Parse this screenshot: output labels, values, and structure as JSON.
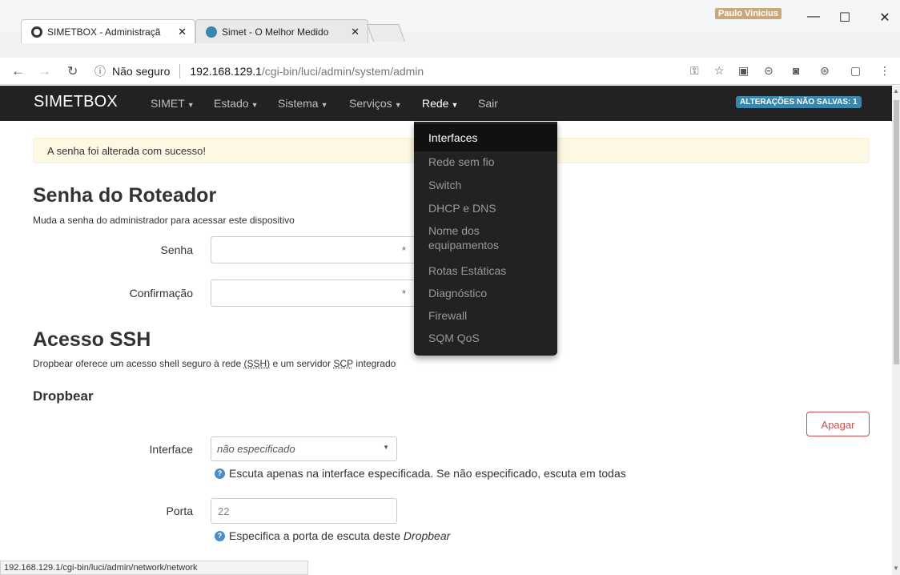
{
  "browser": {
    "tabs": [
      {
        "title": "SIMETBOX - Administraçã",
        "active": true
      },
      {
        "title": "Simet - O Melhor Medido",
        "active": false
      }
    ],
    "tab_close": "✕",
    "user": "Paulo Vinicius",
    "window_controls": {
      "minimize": "—",
      "maximize": "☐",
      "close": "✕"
    },
    "security_label": "Não seguro",
    "url_host": "192.168.129.1",
    "url_path": "/cgi-bin/luci/admin/system/admin",
    "status_url": "192.168.129.1/cgi-bin/luci/admin/network/network"
  },
  "navbar": {
    "brand": "SIMETBOX",
    "items": [
      {
        "label": "SIMET"
      },
      {
        "label": "Estado"
      },
      {
        "label": "Sistema"
      },
      {
        "label": "Serviços"
      },
      {
        "label": "Rede"
      },
      {
        "label": "Sair"
      }
    ],
    "caret": "▼",
    "unsaved_badge": "ALTERAÇÕES NÃO SALVAS: 1"
  },
  "dropdown": {
    "items": [
      {
        "label": "Interfaces",
        "active": true
      },
      {
        "label": "Rede sem fio"
      },
      {
        "label": "Switch"
      },
      {
        "label": "DHCP e DNS"
      },
      {
        "label": "Nome dos equipamentos"
      },
      {
        "label": "Rotas Estáticas"
      },
      {
        "label": "Diagnóstico"
      },
      {
        "label": "Firewall"
      },
      {
        "label": "SQM QoS"
      }
    ]
  },
  "alert": {
    "text": "A senha foi alterada com sucesso!"
  },
  "password_section": {
    "title": "Senha do Roteador",
    "description": "Muda a senha do administrador para acessar este dispositivo",
    "password_label": "Senha",
    "confirm_label": "Confirmação",
    "reveal": "*"
  },
  "ssh_section": {
    "title": "Acesso SSH",
    "desc_before": "Dropbear oferece um acesso shell seguro à rede ",
    "desc_ssh": "(SSH)",
    "desc_mid": " e um servidor ",
    "desc_scp": "SCP",
    "desc_after": " integrado",
    "subtitle": "Dropbear",
    "delete_button": "Apagar",
    "interface_label": "Interface",
    "interface_value": "não especificado",
    "interface_help": "Escuta apenas na interface especificada. Se não especificado, escuta em todas",
    "port_label": "Porta",
    "port_value": "22",
    "port_help_before": "Especifica a porta de escuta deste ",
    "port_help_em": "Dropbear"
  }
}
